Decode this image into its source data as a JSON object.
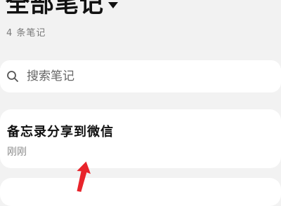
{
  "header": {
    "title": "全部笔记",
    "count_label": "4 条笔记"
  },
  "search": {
    "placeholder": "搜索笔记"
  },
  "notes": [
    {
      "title": "备忘录分享到微信",
      "time": "刚刚"
    }
  ],
  "icons": {
    "search": "search-icon",
    "dropdown": "caret-down-icon",
    "annotation": "red-arrow-icon"
  },
  "colors": {
    "background": "#f2f2f2",
    "card": "#ffffff",
    "annotation_arrow": "#e8242b"
  }
}
